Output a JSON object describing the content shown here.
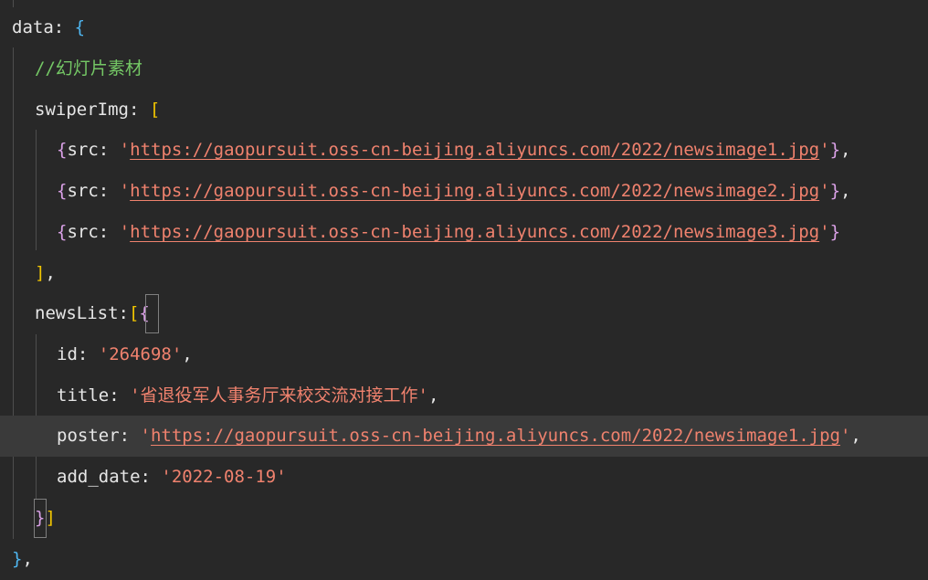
{
  "code": {
    "line1": {
      "key": "data",
      "sep": ": ",
      "open": "{"
    },
    "line2": {
      "comment": "//幻灯片素材"
    },
    "line3": {
      "key": "swiperImg",
      "sep": ": ",
      "open": "["
    },
    "line4": {
      "open": "{",
      "key": "src",
      "sep": ": ",
      "q1": "'",
      "url": "https://gaopursuit.oss-cn-beijing.aliyuncs.com/2022/newsimage1.jpg",
      "q2": "'",
      "close": "}",
      "tail": ","
    },
    "line5": {
      "open": "{",
      "key": "src",
      "sep": ": ",
      "q1": "'",
      "url": "https://gaopursuit.oss-cn-beijing.aliyuncs.com/2022/newsimage2.jpg",
      "q2": "'",
      "close": "}",
      "tail": ","
    },
    "line6": {
      "open": "{",
      "key": "src",
      "sep": ": ",
      "q1": "'",
      "url": "https://gaopursuit.oss-cn-beijing.aliyuncs.com/2022/newsimage3.jpg",
      "q2": "'",
      "close": "}"
    },
    "line7": {
      "close": "]",
      "tail": ","
    },
    "line8": {
      "key": "newsList",
      "sep": ":",
      "open1": "[",
      "open2": "{"
    },
    "line9": {
      "key": "id",
      "sep": ": ",
      "value": "'264698'",
      "tail": ","
    },
    "line10": {
      "key": "title",
      "sep": ": ",
      "value": "'省退役军人事务厅来校交流对接工作'",
      "tail": ","
    },
    "line11": {
      "key": "poster",
      "sep": ": ",
      "q1": "'",
      "url": "https://gaopursuit.oss-cn-beijing.aliyuncs.com/2022/newsimage1.jpg",
      "q2": "'",
      "tail": ","
    },
    "line12": {
      "key": "add_date",
      "sep": ": ",
      "value": "'2022-08-19'"
    },
    "line13": {
      "close1": "}",
      "close2": "]"
    },
    "line14": {
      "close": "}",
      "tail": ","
    }
  },
  "colors": {
    "background": "#282828",
    "current_line": "#3a3a3a",
    "text": "#e6e6e6",
    "string": "#f0826e",
    "comment": "#74c765",
    "brace_purple": "#d9a0e6",
    "brace_blue": "#4fb6f0",
    "bracket_yellow": "#f0c400"
  }
}
